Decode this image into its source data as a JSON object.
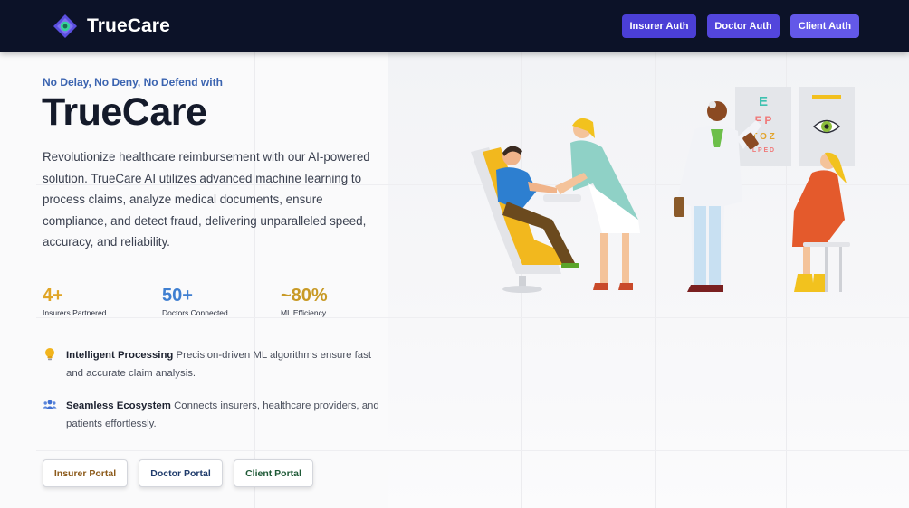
{
  "header": {
    "brand": "TrueCare",
    "buttons": {
      "insurer_auth": "Insurer Auth",
      "doctor_auth": "Doctor Auth",
      "client_auth": "Client Auth"
    }
  },
  "hero": {
    "tagline": "No Delay, No Deny, No Defend with",
    "title": "TrueCare",
    "description": "Revolutionize healthcare reimbursement with our AI-powered solution. TrueCare AI utilizes advanced machine learning to process claims, analyze medical documents, ensure compliance, and detect fraud, delivering unparalleled speed, accuracy, and reliability."
  },
  "stats": [
    {
      "value": "4+",
      "label": "Insurers Partnered",
      "color": "#e0a526"
    },
    {
      "value": "50+",
      "label": "Doctors Connected",
      "color": "#3f7fd1"
    },
    {
      "value": "~80%",
      "label": "ML Efficiency",
      "color": "#c89a26"
    }
  ],
  "features": [
    {
      "icon": "lightbulb-icon",
      "title": "Intelligent Processing",
      "text": "Precision-driven ML algorithms ensure fast and accurate claim analysis."
    },
    {
      "icon": "users-icon",
      "title": "Seamless Ecosystem",
      "text": "Connects insurers, healthcare providers, and patients effortlessly."
    }
  ],
  "portals": {
    "insurer": "Insurer Portal",
    "doctor": "Doctor Portal",
    "client": "Client Portal"
  },
  "eye_chart": {
    "row1": "E",
    "row2": "F P",
    "row3": "T O Z",
    "row4": "L P E D"
  },
  "colors": {
    "header_bg": "#0c1228",
    "accent": "#5346dc",
    "tagline": "#3a63b0"
  }
}
